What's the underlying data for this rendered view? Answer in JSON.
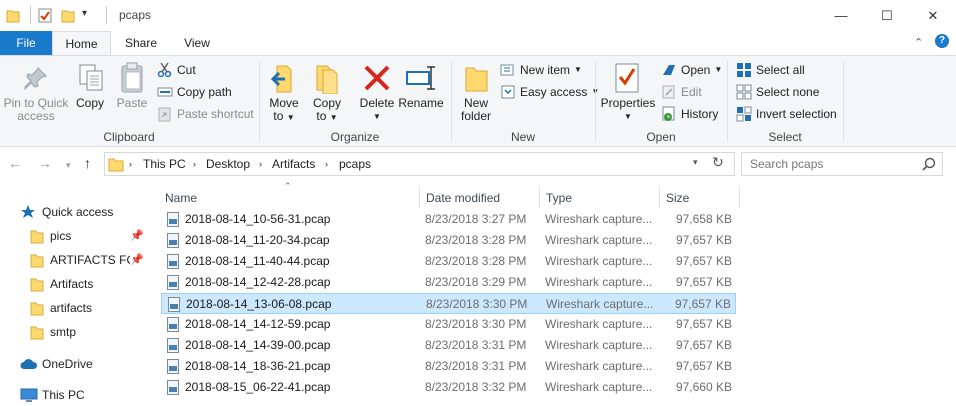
{
  "window": {
    "title": "pcaps",
    "minimize": "—",
    "maximize": "☐",
    "close": "✕"
  },
  "tabs": {
    "file": "File",
    "home": "Home",
    "share": "Share",
    "view": "View"
  },
  "ribbon": {
    "clipboard": {
      "label": "Clipboard",
      "pin_line1": "Pin to Quick",
      "pin_line2": "access",
      "copy": "Copy",
      "paste": "Paste",
      "cut": "Cut",
      "copy_path": "Copy path",
      "paste_shortcut": "Paste shortcut"
    },
    "organize": {
      "label": "Organize",
      "move_line1": "Move",
      "move_line2": "to",
      "copy_line1": "Copy",
      "copy_line2": "to",
      "delete": "Delete",
      "rename": "Rename"
    },
    "new": {
      "label": "New",
      "new_folder_line1": "New",
      "new_folder_line2": "folder",
      "new_item": "New item",
      "easy_access": "Easy access"
    },
    "open": {
      "label": "Open",
      "properties": "Properties",
      "open": "Open",
      "edit": "Edit",
      "history": "History"
    },
    "select": {
      "label": "Select",
      "select_all": "Select all",
      "select_none": "Select none",
      "invert_selection": "Invert selection"
    }
  },
  "address": {
    "crumbs": [
      "This PC",
      "Desktop",
      "Artifacts",
      "pcaps"
    ],
    "search_placeholder": "Search pcaps"
  },
  "nav_pane": {
    "quick_access": "Quick access",
    "items": [
      "pics",
      "ARTIFACTS FOR",
      "Artifacts",
      "artifacts",
      "smtp"
    ],
    "onedrive": "OneDrive",
    "this_pc": "This PC"
  },
  "columns": {
    "name": "Name",
    "date": "Date modified",
    "type": "Type",
    "size": "Size"
  },
  "files": [
    {
      "name": "2018-08-14_10-56-31.pcap",
      "date": "8/23/2018 3:27 PM",
      "type": "Wireshark capture...",
      "size": "97,658 KB"
    },
    {
      "name": "2018-08-14_11-20-34.pcap",
      "date": "8/23/2018 3:28 PM",
      "type": "Wireshark capture...",
      "size": "97,657 KB"
    },
    {
      "name": "2018-08-14_11-40-44.pcap",
      "date": "8/23/2018 3:28 PM",
      "type": "Wireshark capture...",
      "size": "97,657 KB"
    },
    {
      "name": "2018-08-14_12-42-28.pcap",
      "date": "8/23/2018 3:29 PM",
      "type": "Wireshark capture...",
      "size": "97,657 KB"
    },
    {
      "name": "2018-08-14_13-06-08.pcap",
      "date": "8/23/2018 3:30 PM",
      "type": "Wireshark capture...",
      "size": "97,657 KB"
    },
    {
      "name": "2018-08-14_14-12-59.pcap",
      "date": "8/23/2018 3:30 PM",
      "type": "Wireshark capture...",
      "size": "97,657 KB"
    },
    {
      "name": "2018-08-14_14-39-00.pcap",
      "date": "8/23/2018 3:31 PM",
      "type": "Wireshark capture...",
      "size": "97,657 KB"
    },
    {
      "name": "2018-08-14_18-36-21.pcap",
      "date": "8/23/2018 3:31 PM",
      "type": "Wireshark capture...",
      "size": "97,657 KB"
    },
    {
      "name": "2018-08-15_06-22-41.pcap",
      "date": "8/23/2018 3:32 PM",
      "type": "Wireshark capture...",
      "size": "97,660 KB"
    }
  ],
  "colors": {
    "file_tab": "#1979ca",
    "selection": "#cce8ff",
    "folder": "#ffd86e"
  }
}
